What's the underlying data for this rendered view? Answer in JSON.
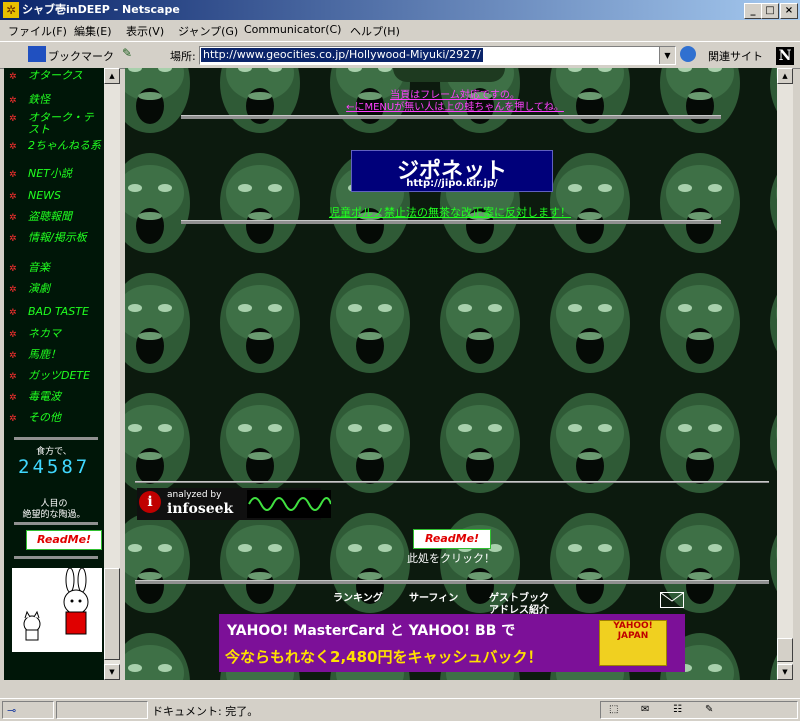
{
  "window": {
    "title": "シャブ壱inDEEP - Netscape",
    "controls": [
      "_",
      "□",
      "×"
    ]
  },
  "menubar": [
    "ファイル(F)",
    "編集(E)",
    "表示(V)",
    "ジャンプ(G)",
    "Communicator(C)",
    "ヘルプ(H)"
  ],
  "toolbar": {
    "bookmarks": "ブックマーク",
    "location_label": "場所:",
    "url": "http://www.geocities.co.jp/Hollywood-Miyuki/2927/",
    "related": "関連サイト"
  },
  "sidebar": {
    "items": [
      {
        "label": "オタークス"
      },
      {
        "label": "鉄怪"
      },
      {
        "label": "オターク・テスト"
      },
      {
        "label": "2ちゃんねる系"
      },
      {
        "label": "NET小説"
      },
      {
        "label": "NEWS"
      },
      {
        "label": "盗聴報聞"
      },
      {
        "label": "情報/掲示板"
      },
      {
        "label": "音楽"
      },
      {
        "label": "演劇"
      },
      {
        "label": "BAD TASTE"
      },
      {
        "label": "ネカマ"
      },
      {
        "label": "馬鹿！"
      },
      {
        "label": "ガッツDETE"
      },
      {
        "label": "毒電波"
      },
      {
        "label": "その他"
      }
    ],
    "counter_label": "食方で、",
    "counter": "24587",
    "counter_caption_1": "人目の",
    "counter_caption_2": "絶望的な陶過。",
    "readme": "ReadMe!"
  },
  "main": {
    "frame_note_1": "当頁はフレーム対応ですの。",
    "frame_note_2": "←にMENUが無い人は上の蛙ちゃんを押してね。",
    "banner_title": "ジポネット",
    "banner_url": "http://jipo.kir.jp/",
    "protest": "児童ポルノ禁止法の無茶な改正案に反対します！",
    "infoseek_small": "analyzed by",
    "infoseek_big": "infoseek",
    "readme": "ReadMe!",
    "click_text": "此処をクリック！",
    "footer_links": {
      "ranking": "ランキング",
      "surfin": "サーフィン",
      "guestbook": "ゲストブック",
      "address": "アドレス紹介"
    },
    "ad": {
      "top": "YAHOO! MasterCard と YAHOO! BB で",
      "bottom": "今ならもれなく2,480円をキャッシュバック！",
      "card": "YAHOO! JAPAN"
    }
  },
  "status": {
    "text": "ドキュメント: 完了。"
  },
  "colors": {
    "link_green": "#20ff20",
    "link_magenta": "#ff40ff",
    "background": "#0c1a0e"
  }
}
